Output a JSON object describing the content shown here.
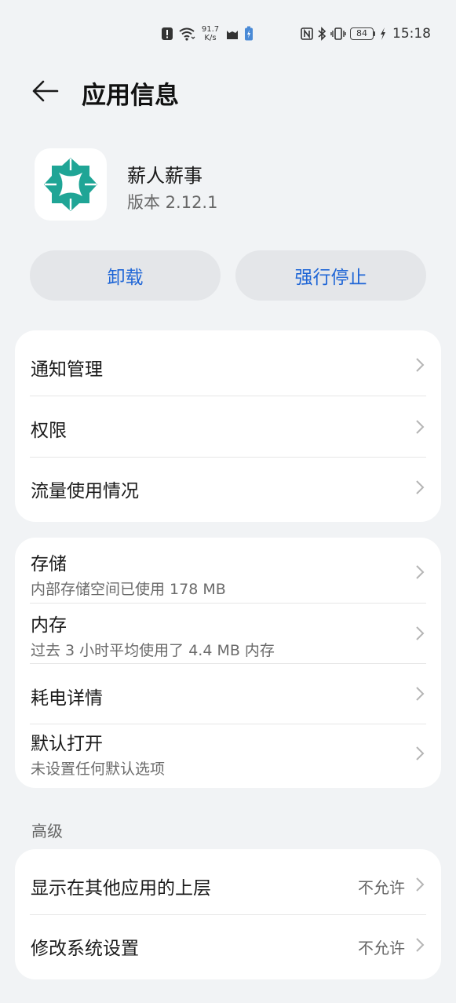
{
  "status_bar": {
    "net_speed_value": "91.7",
    "net_speed_unit": "K/s",
    "battery_level": "84",
    "time": "15:18"
  },
  "header": {
    "title": "应用信息"
  },
  "app": {
    "name": "薪人薪事",
    "version": "版本 2.12.1",
    "icon_color": "#1fa596"
  },
  "actions": {
    "uninstall": "卸载",
    "force_stop": "强行停止"
  },
  "card1": {
    "notification": "通知管理",
    "permissions": "权限",
    "data_usage": "流量使用情况"
  },
  "card2": {
    "storage_title": "存储",
    "storage_sub": "内部存储空间已使用 178 MB",
    "memory_title": "内存",
    "memory_sub": "过去 3 小时平均使用了 4.4 MB 内存",
    "battery_title": "耗电详情",
    "default_title": "默认打开",
    "default_sub": "未设置任何默认选项"
  },
  "advanced": {
    "label": "高级",
    "overlay_title": "显示在其他应用的上层",
    "overlay_value": "不允许",
    "system_settings_title": "修改系统设置",
    "system_settings_value": "不允许"
  },
  "colors": {
    "accent": "#1f66d6",
    "background": "#f1f3f5"
  }
}
